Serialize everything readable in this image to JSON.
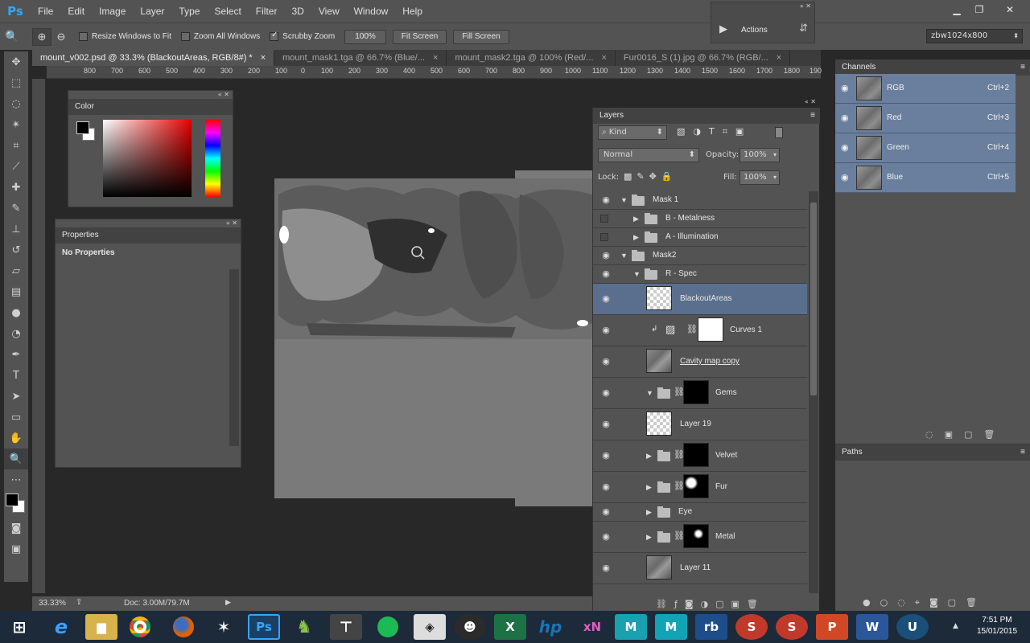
{
  "app": {
    "logo": "Ps"
  },
  "menu": [
    "File",
    "Edit",
    "Image",
    "Layer",
    "Type",
    "Select",
    "Filter",
    "3D",
    "View",
    "Window",
    "Help"
  ],
  "options": {
    "resize_windows": "Resize Windows to Fit",
    "zoom_all": "Zoom All Windows",
    "scrubby_zoom": "Scrubby Zoom",
    "btn_100": "100%",
    "btn_fit": "Fit Screen",
    "btn_fill": "Fill Screen"
  },
  "actions_panel": {
    "label": "Actions"
  },
  "workspace": {
    "value": "zbw1024x800"
  },
  "tabs": [
    {
      "label": "mount_v002.psd @ 33.3% (BlackoutAreas, RGB/8#) *",
      "active": true
    },
    {
      "label": "mount_mask1.tga @ 66.7% (Blue/...",
      "active": false
    },
    {
      "label": "mount_mask2.tga @ 100% (Red/...",
      "active": false
    },
    {
      "label": "Fur0016_S (1).jpg @ 66.7% (RGB/...",
      "active": false
    }
  ],
  "ruler": [
    "800",
    "700",
    "600",
    "500",
    "400",
    "300",
    "200",
    "100",
    "0",
    "100",
    "200",
    "300",
    "400",
    "500",
    "600",
    "700",
    "800",
    "900",
    "1000",
    "1100",
    "1200",
    "1300",
    "1400",
    "1500",
    "1600",
    "1700",
    "1800",
    "190"
  ],
  "color_panel": {
    "title": "Color"
  },
  "properties_panel": {
    "title": "Properties",
    "content": "No Properties"
  },
  "status": {
    "zoom": "33.33%",
    "doc": "Doc: 3.00M/79.7M"
  },
  "layers": {
    "title": "Layers",
    "filter": "Kind",
    "blend": "Normal",
    "opacity_label": "Opacity:",
    "opacity": "100%",
    "lock_label": "Lock:",
    "fill_label": "Fill:",
    "fill": "100%",
    "rows": [
      {
        "name": "Mask 1"
      },
      {
        "name": "B - Metalness"
      },
      {
        "name": "A - Illumination"
      },
      {
        "name": "Mask2"
      },
      {
        "name": "R - Spec"
      },
      {
        "name": "BlackoutAreas"
      },
      {
        "name": "Curves 1"
      },
      {
        "name": "Cavity map copy"
      },
      {
        "name": "Gems"
      },
      {
        "name": "Layer 19"
      },
      {
        "name": "Velvet"
      },
      {
        "name": "Fur"
      },
      {
        "name": "Eye"
      },
      {
        "name": "Metal"
      },
      {
        "name": "Layer 11"
      }
    ]
  },
  "channels": {
    "title": "Channels",
    "rows": [
      {
        "name": "RGB",
        "shortcut": "Ctrl+2"
      },
      {
        "name": "Red",
        "shortcut": "Ctrl+3"
      },
      {
        "name": "Green",
        "shortcut": "Ctrl+4"
      },
      {
        "name": "Blue",
        "shortcut": "Ctrl+5"
      }
    ]
  },
  "paths": {
    "title": "Paths"
  },
  "taskbar": {
    "icons": [
      "windows-start",
      "internet-explorer",
      "file-explorer",
      "chrome",
      "firefox",
      "zbrush",
      "photoshop",
      "marmoset",
      "topogun",
      "spotify",
      "quixel",
      "xnormal",
      "excel",
      "hp",
      "xn",
      "mudbox",
      "maya",
      "rhino",
      "substance",
      "substance-painter",
      "powerpoint",
      "word",
      "unreal"
    ],
    "time": "7:51 PM",
    "date": "15/01/2015",
    "labels": {
      "ie": "e",
      "ps": "Ps",
      "excel": "X",
      "hp": "hp",
      "xn": "xN",
      "rb": "rb",
      "ppt": "P",
      "word": "W",
      "ue": "U"
    }
  }
}
